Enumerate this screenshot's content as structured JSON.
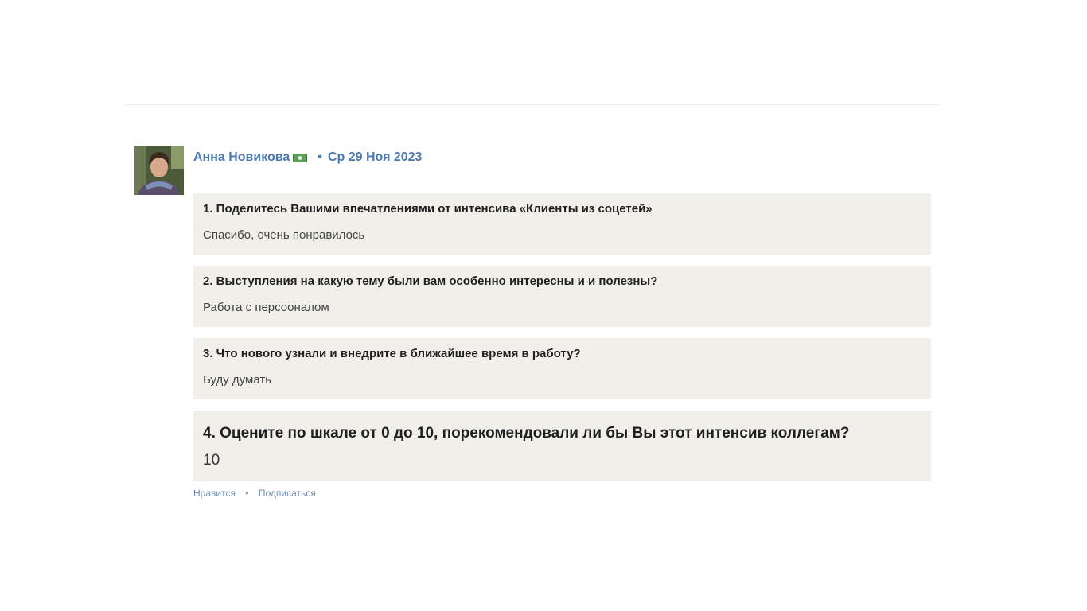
{
  "post": {
    "author": "Анна Новикова",
    "flag_icon": "flag-icon",
    "separator": "•",
    "date": "Ср 29 Ноя 2023",
    "qa": [
      {
        "question": "1. Поделитесь Вашими впечатлениями от интенсива «Клиенты из соцетей»",
        "answer": "Спасибо, очень понравилось"
      },
      {
        "question": "2. Выступления на какую тему были вам особенно интересны и и полезны?",
        "answer": "Работа с персооналом"
      },
      {
        "question": "3. Что нового узнали и внедрите в ближайшее время в работу?",
        "answer": "Буду думать"
      },
      {
        "question": "4. Оцените по шкале от 0 до 10, порекомендовали ли бы Вы этот интенсив коллегам?",
        "answer": "10"
      }
    ],
    "actions": {
      "like": "Нравится",
      "separator": "•",
      "subscribe": "Подписаться"
    }
  },
  "colors": {
    "link": "#4a7ab0",
    "card_background": "#f0efea"
  }
}
